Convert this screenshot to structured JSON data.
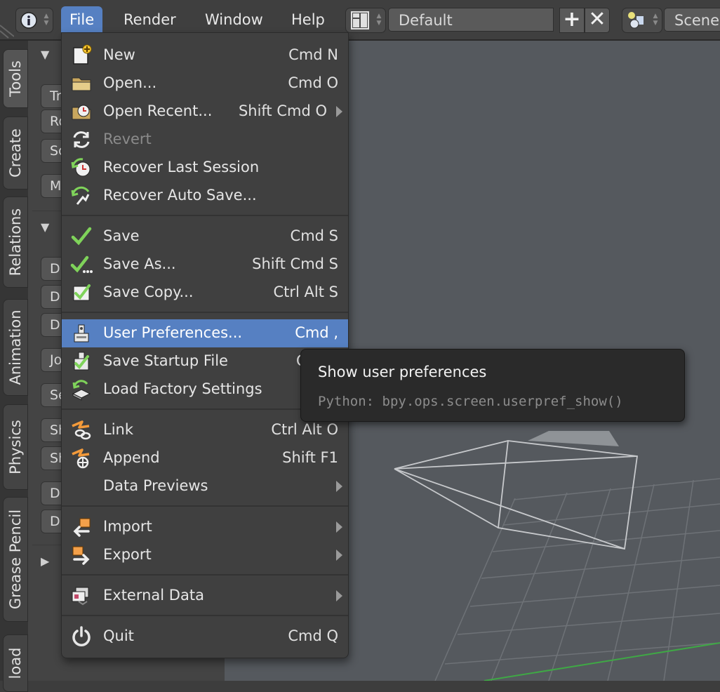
{
  "header": {
    "info_icon": "info-icon",
    "menus": [
      "File",
      "Render",
      "Window",
      "Help"
    ],
    "screen_layout": "Default",
    "layout_add_icon": "plus-icon",
    "layout_delete_icon": "x-icon",
    "scene_name": "Scene"
  },
  "left_tabs": [
    "Tools",
    "Create",
    "Relations",
    "Animation",
    "Physics",
    "Grease Pencil",
    "load"
  ],
  "tool_panel": {
    "rows": [
      "Tr",
      "Ro",
      "Sc",
      "M",
      "D",
      "D",
      "D",
      "Jo",
      "Se",
      "Sh",
      "Sh",
      "D",
      "D"
    ]
  },
  "file_menu": {
    "groups": [
      [
        {
          "label": "New",
          "shortcut": "Cmd N",
          "icon": "new-file-icon"
        },
        {
          "label": "Open...",
          "shortcut": "Cmd O",
          "icon": "folder-open-icon"
        },
        {
          "label": "Open Recent...",
          "shortcut": "Shift Cmd O",
          "icon": "open-recent-icon",
          "submenu": true
        },
        {
          "label": "Revert",
          "shortcut": "",
          "icon": "revert-icon",
          "disabled": true
        },
        {
          "label": "Recover Last Session",
          "shortcut": "",
          "icon": "recover-last-icon"
        },
        {
          "label": "Recover Auto Save...",
          "shortcut": "",
          "icon": "recover-auto-icon"
        }
      ],
      [
        {
          "label": "Save",
          "shortcut": "Cmd S",
          "icon": "checkmark-icon"
        },
        {
          "label": "Save As...",
          "shortcut": "Shift Cmd S",
          "icon": "save-as-icon"
        },
        {
          "label": "Save Copy...",
          "shortcut": "Ctrl Alt S",
          "icon": "save-copy-icon"
        }
      ],
      [
        {
          "label": "User Preferences...",
          "shortcut": "Cmd ,",
          "icon": "preferences-icon",
          "highlighted": true
        },
        {
          "label": "Save Startup File",
          "shortcut": "C",
          "icon": "save-startup-icon"
        },
        {
          "label": "Load Factory Settings",
          "shortcut": "",
          "icon": "load-factory-icon"
        }
      ],
      [
        {
          "label": "Link",
          "shortcut": "Ctrl Alt O",
          "icon": "link-icon"
        },
        {
          "label": "Append",
          "shortcut": "Shift F1",
          "icon": "append-icon"
        },
        {
          "label": "Data Previews",
          "shortcut": "",
          "icon": "",
          "submenu": true
        }
      ],
      [
        {
          "label": "Import",
          "shortcut": "",
          "icon": "import-icon",
          "submenu": true
        },
        {
          "label": "Export",
          "shortcut": "",
          "icon": "export-icon",
          "submenu": true
        }
      ],
      [
        {
          "label": "External Data",
          "shortcut": "",
          "icon": "external-data-icon",
          "submenu": true
        }
      ],
      [
        {
          "label": "Quit",
          "shortcut": "Cmd Q",
          "icon": "power-icon"
        }
      ]
    ]
  },
  "tooltip": {
    "title": "Show user preferences",
    "python": "Python: bpy.ops.screen.userpref_show()"
  },
  "colors": {
    "highlight": "#5680c2",
    "menu_bg": "#404040",
    "viewport_bg": "#55595e",
    "check_green": "#7fd35a"
  }
}
